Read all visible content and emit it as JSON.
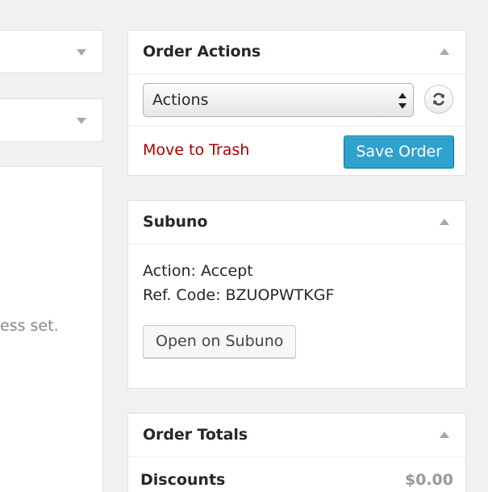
{
  "left_column": {
    "address_note": "ess set."
  },
  "order_actions": {
    "title": "Order Actions",
    "select_value": "Actions",
    "trash_label": "Move to Trash",
    "save_label": "Save Order"
  },
  "subuno": {
    "title": "Subuno",
    "action_line": "Action: Accept",
    "ref_line": "Ref. Code: BZUOPWTKGF",
    "open_label": "Open on Subuno"
  },
  "order_totals": {
    "title": "Order Totals",
    "discounts_label": "Discounts",
    "discounts_value": "$0.00"
  },
  "colors": {
    "primary_button": "#2ea2cc",
    "trash_link": "#aa0000"
  }
}
